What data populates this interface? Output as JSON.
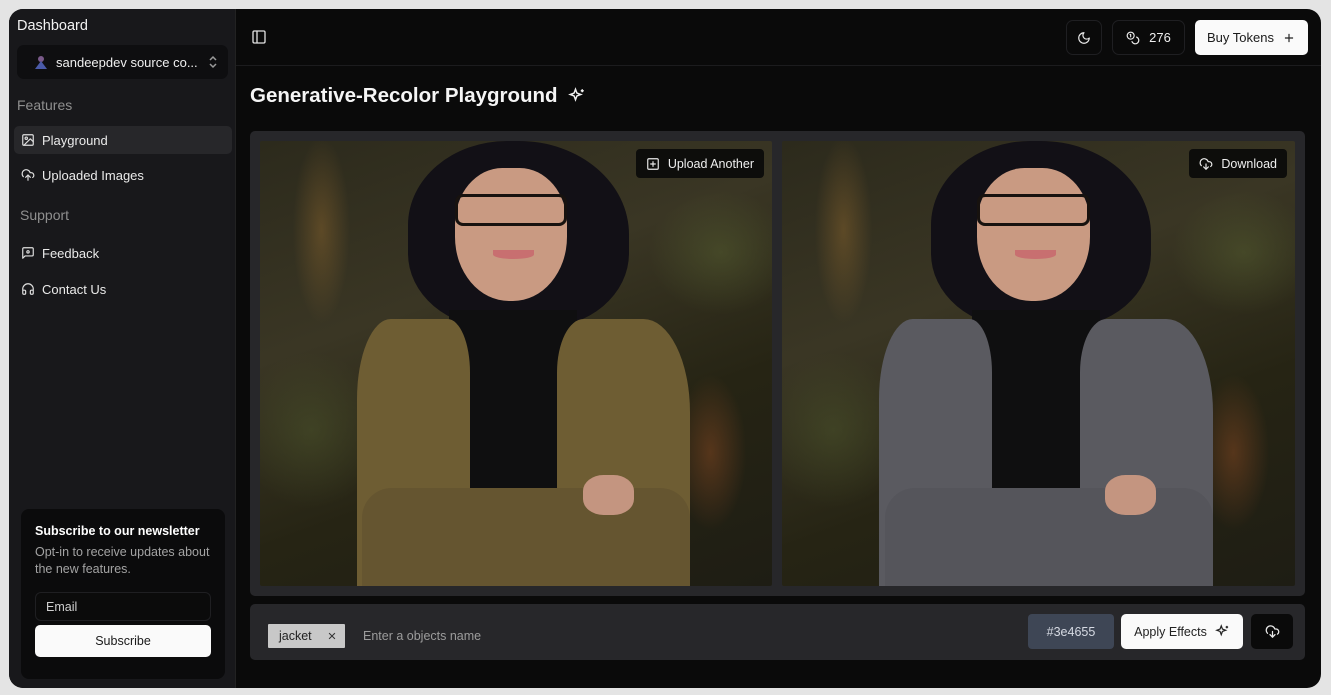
{
  "sidebar": {
    "title": "Dashboard",
    "workspace": {
      "name": "sandeepdev source co...",
      "avatar_icon": "user-avatar",
      "chevron_icon": "chevrons-up-down-icon"
    },
    "groups": [
      {
        "label": "Features",
        "items": [
          {
            "label": "Playground",
            "icon": "image-icon",
            "active": true
          },
          {
            "label": "Uploaded Images",
            "icon": "cloud-upload-icon",
            "active": false
          }
        ]
      },
      {
        "label": "Support",
        "items": [
          {
            "label": "Feedback",
            "icon": "message-square-icon",
            "active": false
          },
          {
            "label": "Contact Us",
            "icon": "headphones-icon",
            "active": false
          }
        ]
      }
    ],
    "newsletter": {
      "title": "Subscribe to our newsletter",
      "description": "Opt-in to receive updates about the new features.",
      "email_placeholder": "Email",
      "email_value": "",
      "subscribe_label": "Subscribe"
    }
  },
  "topbar": {
    "toggle_icon": "panel-left-icon",
    "theme_icon": "moon-icon",
    "tokens": {
      "icon": "coins-icon",
      "count": "276"
    },
    "buy_tokens_label": "Buy Tokens",
    "buy_tokens_icon": "plus-icon"
  },
  "page": {
    "title": "Generative-Recolor Playground",
    "title_icon": "sparkles-icon"
  },
  "images": {
    "original": {
      "action_label": "Upload Another",
      "action_icon": "plus-square-icon",
      "jacket_color": "#6e5d33"
    },
    "result": {
      "action_label": "Download",
      "action_icon": "cloud-download-icon",
      "jacket_color": "#5a5a60"
    }
  },
  "controls": {
    "tags": [
      {
        "label": "jacket",
        "remove_icon": "x-icon"
      }
    ],
    "object_input_placeholder": "Enter a objects name",
    "object_input_value": "",
    "color_value": "#3e4655",
    "apply_label": "Apply Effects",
    "apply_icon": "sparkles-icon",
    "download_icon": "cloud-download-icon"
  },
  "colors": {
    "frame": "#e4e4e4",
    "sidebar_bg": "#18181b",
    "main_bg": "#0a0a0a",
    "panel_bg": "#27272a",
    "accent_button": "#fafafa",
    "color_chip": "#3e4655"
  }
}
